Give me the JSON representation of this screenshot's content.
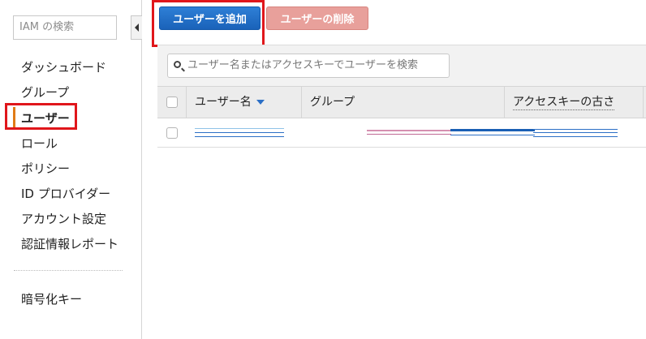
{
  "sidebar": {
    "search_placeholder": "IAM の検索",
    "items": [
      {
        "label": "ダッシュボード"
      },
      {
        "label": "グループ"
      },
      {
        "label": "ユーザー"
      },
      {
        "label": "ロール"
      },
      {
        "label": "ポリシー"
      },
      {
        "label": "ID プロバイダー"
      },
      {
        "label": "アカウント設定"
      },
      {
        "label": "認証情報レポート"
      }
    ],
    "bottom_item": "暗号化キー",
    "active_index": 2
  },
  "toolbar": {
    "add_user": "ユーザーを追加",
    "delete_user": "ユーザーの削除"
  },
  "filter": {
    "placeholder": "ユーザー名またはアクセスキーでユーザーを検索"
  },
  "table": {
    "columns": [
      "ユーザー名",
      "グループ",
      "アクセスキーの古さ"
    ]
  },
  "colors": {
    "primary_button": "#1a62b9",
    "danger_button_disabled": "#e8a09b",
    "active_nav": "#e07b16",
    "highlight": "#e0161b"
  }
}
